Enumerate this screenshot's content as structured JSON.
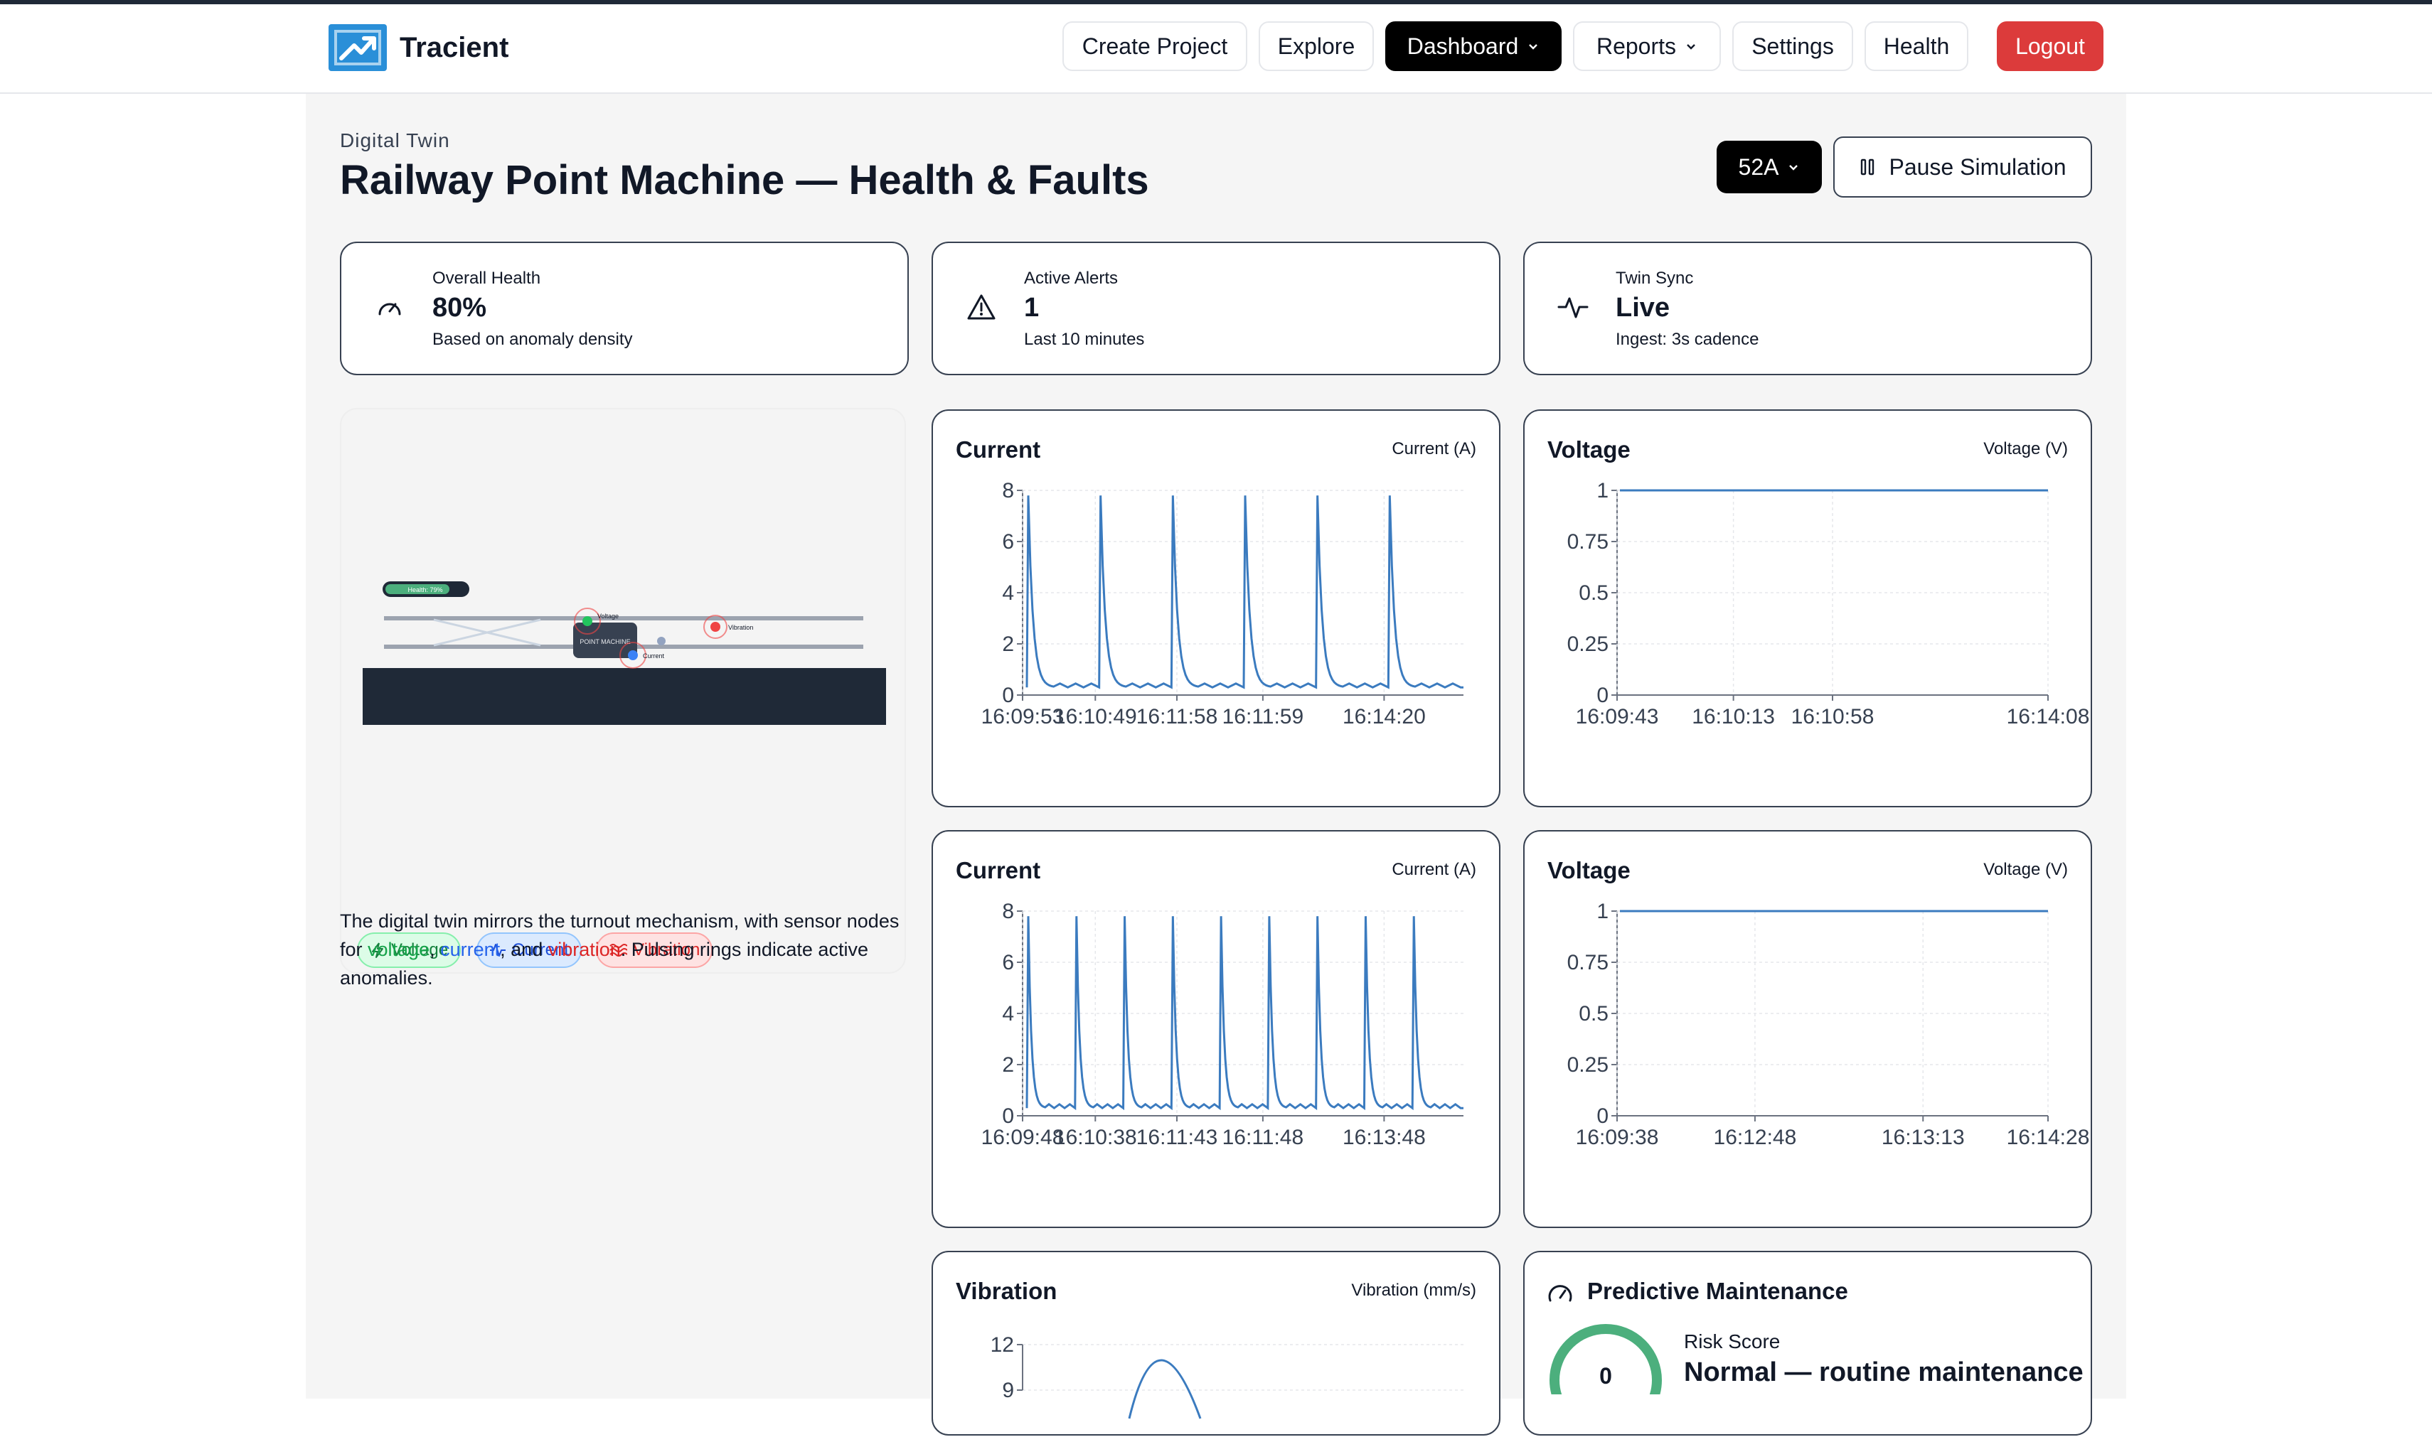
{
  "app": {
    "name": "Tracient"
  },
  "nav": {
    "create_project": "Create Project",
    "explore": "Explore",
    "dashboard": "Dashboard",
    "reports": "Reports",
    "settings": "Settings",
    "health": "Health",
    "logout": "Logout"
  },
  "header": {
    "eyebrow": "Digital Twin",
    "title": "Railway Point Machine — Health & Faults",
    "device": "52A",
    "pause": "Pause Simulation"
  },
  "stats": [
    {
      "label": "Overall Health",
      "value": "80%",
      "sub": "Based on anomaly density",
      "icon": "gauge-icon"
    },
    {
      "label": "Active Alerts",
      "value": "1",
      "sub": "Last 10 minutes",
      "icon": "warning-triangle-icon"
    },
    {
      "label": "Twin Sync",
      "value": "Live",
      "sub": "Ingest: 3s cadence",
      "icon": "activity-icon"
    }
  ],
  "twin": {
    "health_tag": "Health: 79%",
    "machine_label": "POINT MACHINE",
    "sensor_voltage": "Voltage",
    "sensor_current": "Current",
    "sensor_vibration": "Vibration",
    "chips": {
      "voltage": "Voltage",
      "current": "Current",
      "vibration": "Vibration"
    },
    "desc_pre": "The digital twin mirrors the turnout mechanism, with sensor nodes for ",
    "desc_voltage": "voltage",
    "desc_sep1": ", ",
    "desc_current": "current",
    "desc_sep2": ", and ",
    "desc_vibration": "vibration",
    "desc_post": ". Pulsing rings indicate active anomalies."
  },
  "colors": {
    "line": "#3b7bbf",
    "gauge": "#4caf7d",
    "logout": "#dc3b3b",
    "voltage": "#16a34a",
    "current": "#2563eb",
    "vibration": "#dc2626"
  },
  "chart_data": [
    {
      "type": "line",
      "title": "Current",
      "ylabel": "Current (A)",
      "ylim": [
        0,
        8
      ],
      "yticks": [
        "8",
        "6",
        "4",
        "2",
        "0"
      ],
      "xticks": [
        "16:09:53",
        "16:10:49",
        "16:11:58",
        "16:11:59",
        "16:14:20"
      ],
      "spikes": 6,
      "peak": 7.8,
      "baseline": 0.3
    },
    {
      "type": "line",
      "title": "Voltage",
      "ylabel": "Voltage (V)",
      "ylim": [
        0,
        1
      ],
      "yticks": [
        "1",
        "0.75",
        "0.5",
        "0.25",
        "0"
      ],
      "xticks": [
        "16:09:43",
        "16:10:13",
        "16:10:58",
        "16:14:08"
      ],
      "values": [
        1,
        1
      ]
    },
    {
      "type": "line",
      "title": "Current",
      "ylabel": "Current (A)",
      "ylim": [
        0,
        8
      ],
      "yticks": [
        "8",
        "6",
        "4",
        "2",
        "0"
      ],
      "xticks": [
        "16:09:48",
        "16:10:38",
        "16:11:43",
        "16:11:48",
        "16:13:48"
      ],
      "spikes": 9,
      "peak": 7.8,
      "baseline": 0.3
    },
    {
      "type": "line",
      "title": "Voltage",
      "ylabel": "Voltage (V)",
      "ylim": [
        0,
        1
      ],
      "yticks": [
        "1",
        "0.75",
        "0.5",
        "0.25",
        "0"
      ],
      "xticks": [
        "16:09:38",
        "16:12:48",
        "16:13:13",
        "16:14:28"
      ],
      "values": [
        1,
        1
      ]
    },
    {
      "type": "line",
      "title": "Vibration",
      "ylabel": "Vibration (mm/s)",
      "yticks": [
        "12",
        "9"
      ]
    }
  ],
  "maintenance": {
    "title": "Predictive Maintenance",
    "risk_label": "Risk Score",
    "risk_value": "0",
    "status": "Normal — routine maintenance"
  }
}
